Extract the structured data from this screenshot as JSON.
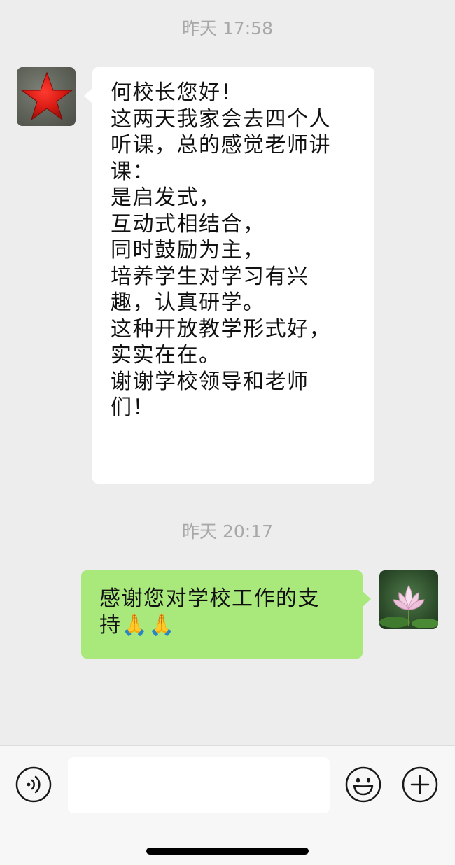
{
  "chat": {
    "timestamps": [
      "昨天 17:58",
      "昨天 20:17"
    ],
    "messages": [
      {
        "side": "left",
        "lines": [
          "何校长您好！",
          "这两天我家会去四个人",
          "听课，总的感觉老师讲",
          "课：",
          "是启发式，",
          "互动式相结合，",
          "同时鼓励为主，",
          "培养学生对学习有兴",
          "趣，认真研学。",
          "这种开放教学形式好，",
          "实实在在。",
          "谢谢学校领导和老师",
          "们！"
        ]
      },
      {
        "side": "right",
        "lines": [
          "感谢您对学校工作的支",
          "持🙏🙏"
        ]
      }
    ]
  },
  "avatars": {
    "left": "red-star-avatar",
    "right": "lotus-flower-avatar"
  },
  "input_bar": {
    "placeholder": "",
    "icons": [
      "voice-icon",
      "emoji-icon",
      "plus-icon"
    ]
  },
  "colors": {
    "chat_background": "#ededed",
    "bubble_left": "#ffffff",
    "bubble_right": "#a9e97c",
    "timestamp": "#a8a8a8",
    "input_bar": "#f7f7f7"
  }
}
